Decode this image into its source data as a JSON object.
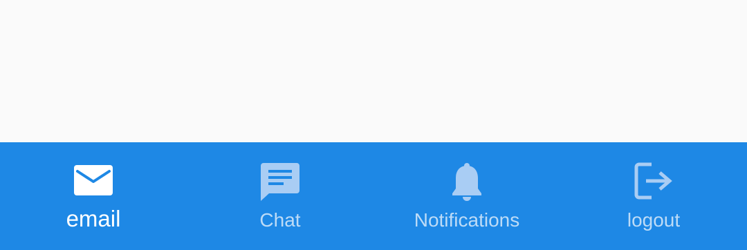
{
  "bottom_nav": {
    "items": [
      {
        "label": "email",
        "icon": "email-icon",
        "active": true
      },
      {
        "label": "Chat",
        "icon": "chat-icon",
        "active": false
      },
      {
        "label": "Notifications",
        "icon": "bell-icon",
        "active": false
      },
      {
        "label": "logout",
        "icon": "logout-icon",
        "active": false
      }
    ]
  },
  "colors": {
    "nav_background": "#1e88e5",
    "content_background": "#fafafa",
    "active": "#ffffff",
    "inactive": "#a9cdf4"
  }
}
